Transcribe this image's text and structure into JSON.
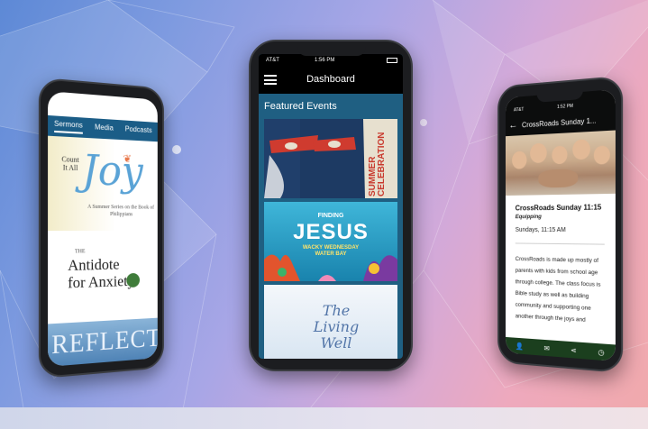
{
  "left_phone": {
    "tabs": [
      {
        "label": "Sermons",
        "active": true
      },
      {
        "label": "Media",
        "active": false
      },
      {
        "label": "Podcasts",
        "active": false
      }
    ],
    "series": [
      {
        "count_text": "Count It All",
        "title": "Joy",
        "subtitle": "A Summer Series on the Book of Philippians"
      },
      {
        "small_text": "THE",
        "title": "Antidote for Anxiety"
      },
      {
        "title": "REFLECT"
      }
    ]
  },
  "center_phone": {
    "status": {
      "carrier": "AT&T",
      "time": "1:56 PM"
    },
    "nav_title": "Dashboard",
    "menu_icon": "hamburger-menu-icon",
    "section_title": "Featured Events",
    "events": [
      {
        "line1": "SUMMER",
        "line2": "CELEBRATION"
      },
      {
        "top": "FINDING",
        "title": "JESUS",
        "sub1": "WACKY WEDNESDAY",
        "sub2": "WATER BAY"
      },
      {
        "title": "The Living Well"
      }
    ]
  },
  "right_phone": {
    "status": {
      "carrier": "AT&T",
      "time": "1:52 PM"
    },
    "nav_title": "CrossRoads Sunday 1...",
    "event_title": "CrossRoads Sunday 11:15",
    "category": "Equipping",
    "datetime": "Sundays, 11:15 AM",
    "description": "CrossRoads is made up mostly of parents with kids from school age through college. The class focus is Bible study as well as building community and supporting one another through the joys and",
    "actions": [
      {
        "icon": "add-person-icon",
        "glyph": "👤"
      },
      {
        "icon": "mail-icon",
        "glyph": "✉"
      },
      {
        "icon": "share-icon",
        "glyph": "⋖"
      },
      {
        "icon": "clock-icon",
        "glyph": "◷"
      }
    ]
  },
  "colors": {
    "background_left": "#5d89d6",
    "background_right": "#f1a9ab",
    "center_screen_bg": "#1f5f82",
    "left_tab_bar": "#1b5d87",
    "right_action_bar": "#1b3f1e"
  }
}
